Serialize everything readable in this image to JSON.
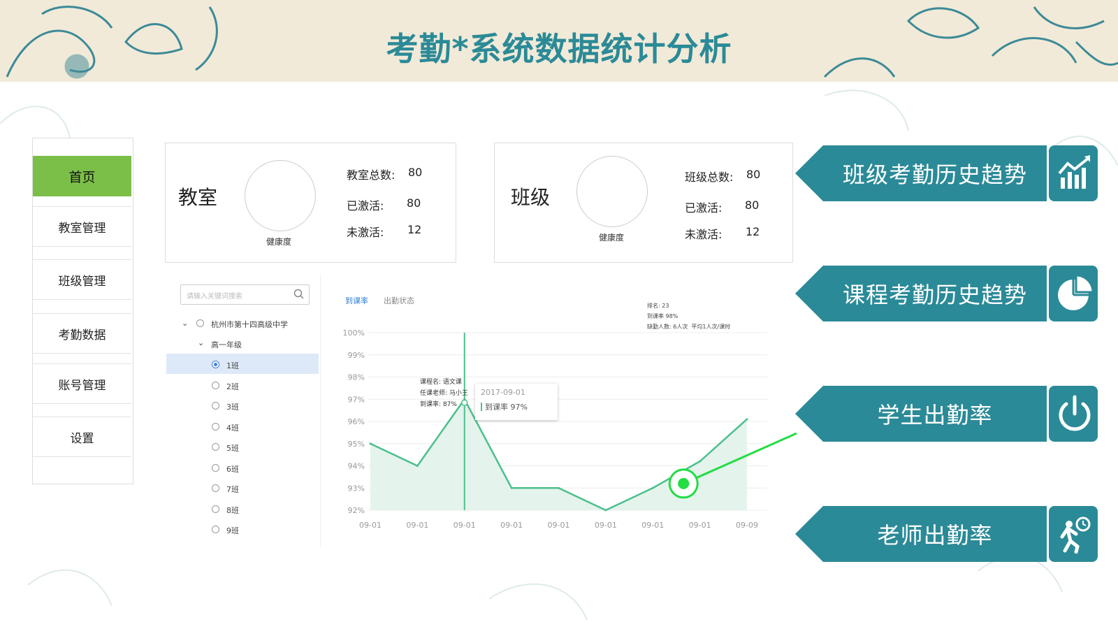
{
  "header": {
    "title": "考勤*系统数据统计分析"
  },
  "sidebar": {
    "items": [
      {
        "label": "首页",
        "active": true
      },
      {
        "label": "教室管理",
        "active": false
      },
      {
        "label": "班级管理",
        "active": false
      },
      {
        "label": "考勤数据",
        "active": false
      },
      {
        "label": "账号管理",
        "active": false
      },
      {
        "label": "设置",
        "active": false
      }
    ]
  },
  "cards": {
    "classroom": {
      "title": "教室",
      "health_label": "健康度",
      "total_label": "教室总数:",
      "total_value": "80",
      "active_label": "已激活:",
      "active_value": "80",
      "inactive_label": "未激活:",
      "inactive_value": "12"
    },
    "class": {
      "title": "班级",
      "health_label": "健康度",
      "total_label": "班级总数:",
      "total_value": "80",
      "active_label": "已激活:",
      "active_value": "80",
      "inactive_label": "未激活:",
      "inactive_value": "12"
    }
  },
  "tree": {
    "search_placeholder": "请输入关键词搜索",
    "school": "杭州市第十四高级中学",
    "grade": "高一年级",
    "classes": [
      "1班",
      "2班",
      "3班",
      "4班",
      "5班",
      "6班",
      "7班",
      "8班",
      "9班"
    ],
    "selected_class": "1班"
  },
  "tabs": [
    {
      "label": "到课率",
      "active": true
    },
    {
      "label": "出勤状态",
      "active": false
    }
  ],
  "info_box": {
    "rank": "排名: 23",
    "rate": "到课率 98%",
    "absent": "缺勤人数: 6人次",
    "avg": "平均1人次/课时"
  },
  "tooltip": {
    "course": "课程名: 语文课",
    "teacher": "任课老师: 马小王",
    "rate": "到课率: 87%",
    "date": "2017-09-01",
    "series_value": "到课率 97%"
  },
  "chart_data": {
    "type": "area",
    "x": [
      "09-01",
      "09-01",
      "09-01",
      "09-01",
      "09-01",
      "09-01",
      "09-01",
      "09-01",
      "09-09"
    ],
    "y_ticks": [
      "100%",
      "99%",
      "98%",
      "97%",
      "96%",
      "95%",
      "94%",
      "93%",
      "92%"
    ],
    "ylim": [
      92,
      100
    ],
    "series": [
      {
        "values": [
          95.0,
          94.0,
          97.0,
          93.0,
          93.0,
          92.0,
          93.0,
          94.2,
          96.1
        ]
      }
    ],
    "grid": true,
    "colors": {
      "line": "#4cbf8c",
      "fill": "#e4f3ec"
    }
  },
  "ribbons": [
    {
      "label": "班级考勤历史趋势",
      "icon": "bar-chart-trend-icon"
    },
    {
      "label": "课程考勤历史趋势",
      "icon": "pie-chart-icon"
    },
    {
      "label": "学生出勤率",
      "icon": "power-icon"
    },
    {
      "label": "老师出勤率",
      "icon": "running-clock-icon"
    }
  ],
  "colors": {
    "accent": "#2b8a97",
    "nav_active": "#7cbf48",
    "highlight": "#22dd44",
    "title": "#2b8a97"
  }
}
